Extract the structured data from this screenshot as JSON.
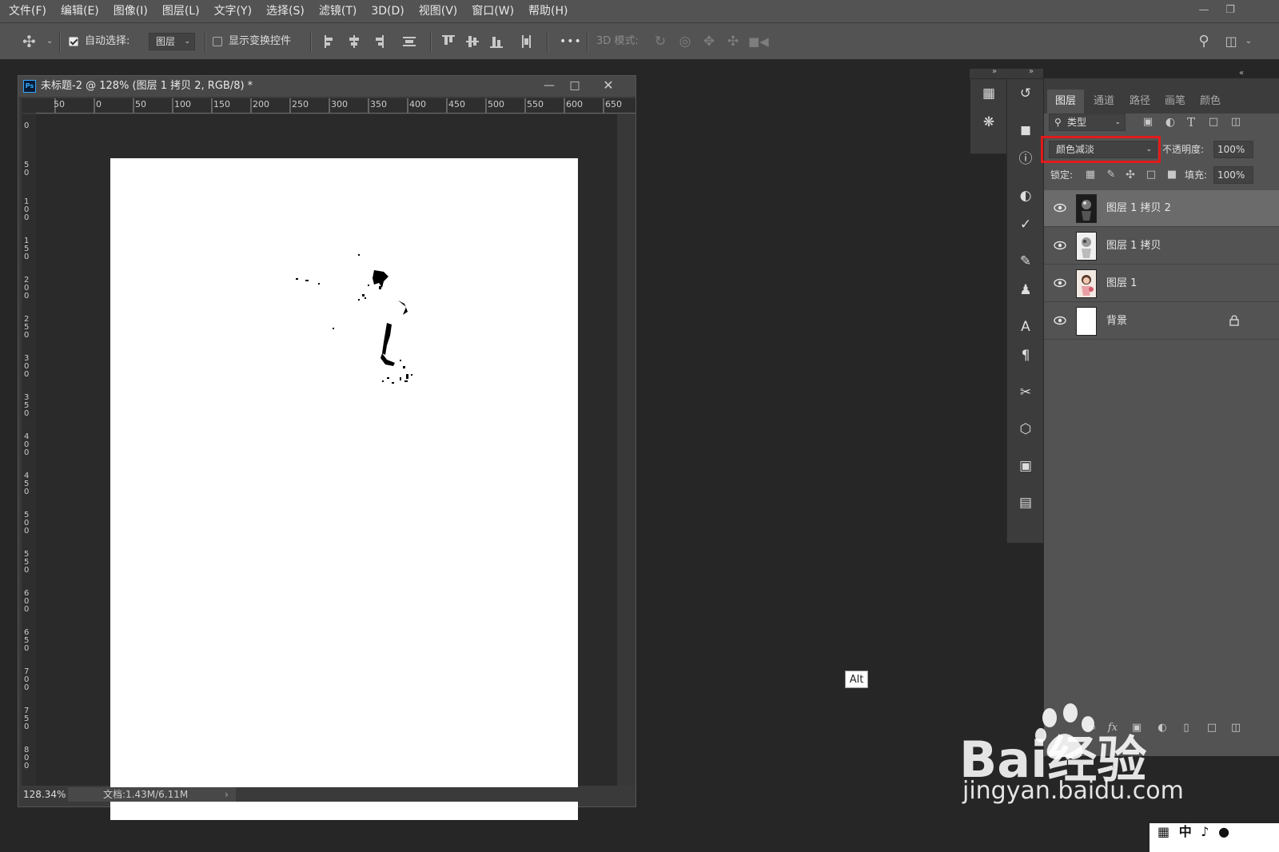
{
  "menu": [
    "文件(F)",
    "编辑(E)",
    "图像(I)",
    "图层(L)",
    "文字(Y)",
    "选择(S)",
    "滤镜(T)",
    "3D(D)",
    "视图(V)",
    "窗口(W)",
    "帮助(H)"
  ],
  "options": {
    "auto_select_label": "自动选择:",
    "auto_select_value": "图层",
    "show_transform_label": "显示变换控件",
    "more": "•••",
    "mode_3d_label": "3D 模式:"
  },
  "document": {
    "title": "未标题-2 @ 128% (图层 1 拷贝 2, RGB/8) *",
    "ruler_top": [
      "50",
      "0",
      "50",
      "100",
      "150",
      "200",
      "250",
      "300",
      "350",
      "400",
      "450",
      "500",
      "550",
      "600",
      "650"
    ],
    "ruler_left": [
      "0",
      "5 0",
      "1 0 0",
      "1 5 0",
      "2 0 0",
      "2 5 0",
      "3 0 0",
      "3 5 0",
      "4 0 0",
      "4 5 0",
      "5 0 0",
      "5 5 0",
      "6 0 0",
      "6 5 0",
      "7 0 0",
      "7 5 0",
      "8 0 0"
    ],
    "zoom": "128.34%",
    "doc_size": "文档:1.43M/6.11M"
  },
  "panel_tabs": [
    "图层",
    "通道",
    "路径",
    "画笔",
    "颜色"
  ],
  "layers_panel": {
    "filter_kind": "类型",
    "blend_mode": "颜色减淡",
    "opacity_label": "不透明度:",
    "opacity_value": "100%",
    "lock_label": "锁定:",
    "fill_label": "填充:",
    "fill_value": "100%",
    "layers": [
      {
        "name": "图层 1 拷贝 2"
      },
      {
        "name": "图层 1 拷贝"
      },
      {
        "name": "图层 1"
      },
      {
        "name": "背景"
      }
    ],
    "fx_label": "fx"
  },
  "alt_badge": "Alt",
  "ime_bar": "中",
  "watermark": {
    "brand": "Bai经验",
    "url": "jingyan.baidu.com"
  },
  "colors": {
    "highlight_box": "#e11b1b",
    "ps_blue": "#31a8ff"
  }
}
